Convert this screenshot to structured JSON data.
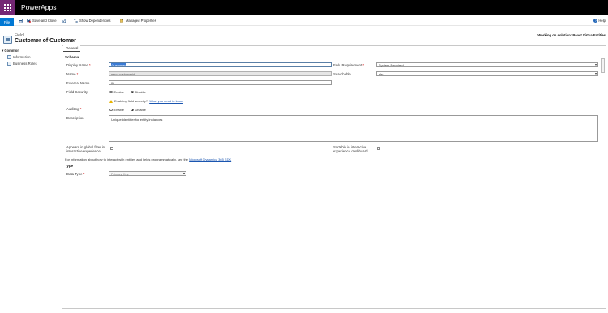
{
  "app": {
    "title": "PowerApps"
  },
  "commandbar": {
    "file_label": "File",
    "save_close_label": "Save and Close",
    "show_dependencies_label": "Show Dependencies",
    "managed_properties_label": "Managed Properties",
    "help_label": "Help"
  },
  "header": {
    "kind": "Field",
    "title": "Customer of Customer",
    "solution_text": "Working on solution: React.VirtualEntities"
  },
  "nav": {
    "common_label": "Common",
    "items": [
      {
        "label": "Information"
      },
      {
        "label": "Business Rules"
      }
    ]
  },
  "tabs": [
    {
      "label": "General"
    }
  ],
  "schema": {
    "section_label": "Schema",
    "display_name": {
      "label": "Display Name",
      "value": "Customer"
    },
    "field_requirement": {
      "label": "Field Requirement",
      "value": "System Required"
    },
    "name": {
      "label": "Name",
      "value": "new_customerid"
    },
    "searchable": {
      "label": "Searchable",
      "value": "Yes"
    },
    "external_name": {
      "label": "External Name",
      "value": "ID"
    },
    "field_security": {
      "label": "Field Security",
      "option_enable": "Enable",
      "option_disable": "Disable",
      "selected": "Disable"
    },
    "security_warning": {
      "text": "Enabling field security?",
      "link": "What you need to know"
    },
    "auditing": {
      "label": "Auditing",
      "option_enable": "Enable",
      "option_disable": "Disable",
      "selected": "Disable"
    },
    "description": {
      "label": "Description",
      "value": "Unique identifier for entity instances"
    },
    "global_filter": {
      "label_line1": "Appears in global filter in",
      "label_line2": "interactive experience",
      "checked": false
    },
    "sortable": {
      "label_line1": "Sortable in interactive",
      "label_line2": "experience dashboard",
      "checked": false
    },
    "info_text": "For information about how to interact with entities and fields programmatically, see the",
    "info_link": "Microsoft Dynamics 365 SDK"
  },
  "type": {
    "section_label": "Type",
    "data_type": {
      "label": "Data Type",
      "value": "Primary Key"
    }
  },
  "colors": {
    "topbar": "#000000",
    "waffle": "#742774",
    "file_button": "#0078d4",
    "link": "#1a55b0",
    "required": "#cc0000"
  }
}
